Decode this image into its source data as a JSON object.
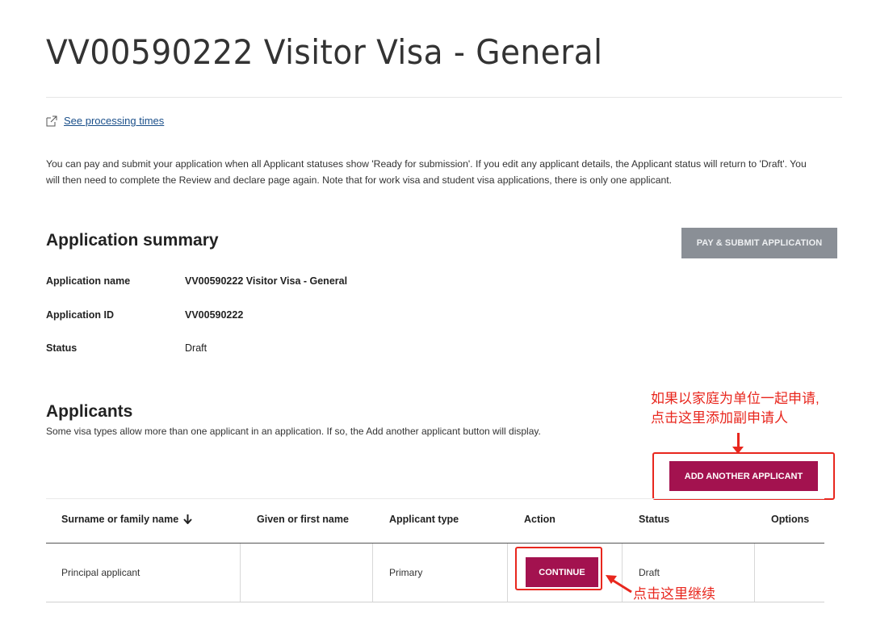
{
  "page": {
    "title": "VV00590222 Visitor Visa - General"
  },
  "links": {
    "processing_times": "See processing times"
  },
  "intro": "You can pay and submit your application when all Applicant statuses show 'Ready for submission'. If you edit any applicant details, the Applicant status will return to 'Draft'. You will then need to complete the Review and declare page again. Note that for work visa and student visa applications, there is only one applicant.",
  "summary": {
    "heading": "Application summary",
    "pay_button": "PAY & SUBMIT APPLICATION",
    "rows": [
      {
        "label": "Application name",
        "value": "VV00590222 Visitor Visa - General"
      },
      {
        "label": "Application ID",
        "value": "VV00590222"
      },
      {
        "label": "Status",
        "value": "Draft"
      }
    ]
  },
  "applicants": {
    "heading": "Applicants",
    "subtext": "Some visa types allow more than one applicant in an application. If so, the Add another applicant button will display.",
    "add_button": "ADD ANOTHER APPLICANT",
    "columns": [
      "Surname or family name",
      "Given or first name",
      "Applicant type",
      "Action",
      "Status",
      "Options"
    ],
    "rows": [
      {
        "surname": "Principal applicant",
        "given": "",
        "type": "Primary",
        "action": "CONTINUE",
        "status": "Draft",
        "options": ""
      }
    ]
  },
  "annotations": {
    "add_line1": "如果以家庭为单位一起申请,",
    "add_line2": "点击这里添加副申请人",
    "continue": "点击这里继续"
  },
  "colors": {
    "primary_button": "#a3124f",
    "disabled_button": "#8a8f96",
    "annotation_red": "#e8271e",
    "link": "#1a4f8a"
  },
  "icons": {
    "external_link": "external-link-icon",
    "sort": "arrow-down-icon"
  }
}
